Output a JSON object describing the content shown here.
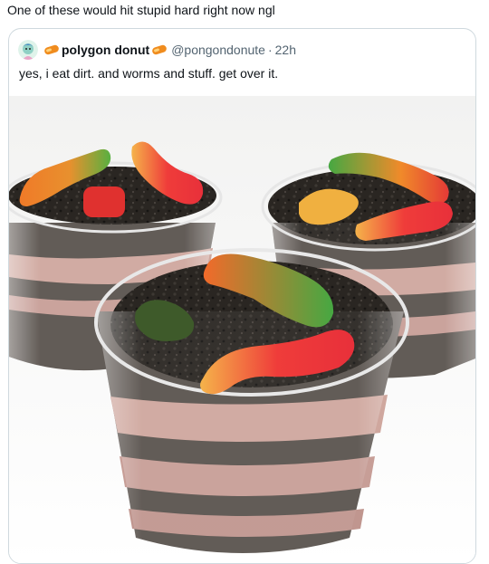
{
  "caption": "One of these would hit stupid hard right now ngl",
  "quoted": {
    "display_name": "polygon donut",
    "handle": "@pongondonute",
    "separator": "·",
    "time": "22h",
    "text": "yes, i eat dirt. and worms and stuff. get over it.",
    "name_emoji": "orange-pill-emoji",
    "avatar_icon": "cartoon-avatar"
  },
  "colors": {
    "secondary_text": "#536471",
    "border": "#cfd9de",
    "pill_emoji": "#f08c1e"
  }
}
